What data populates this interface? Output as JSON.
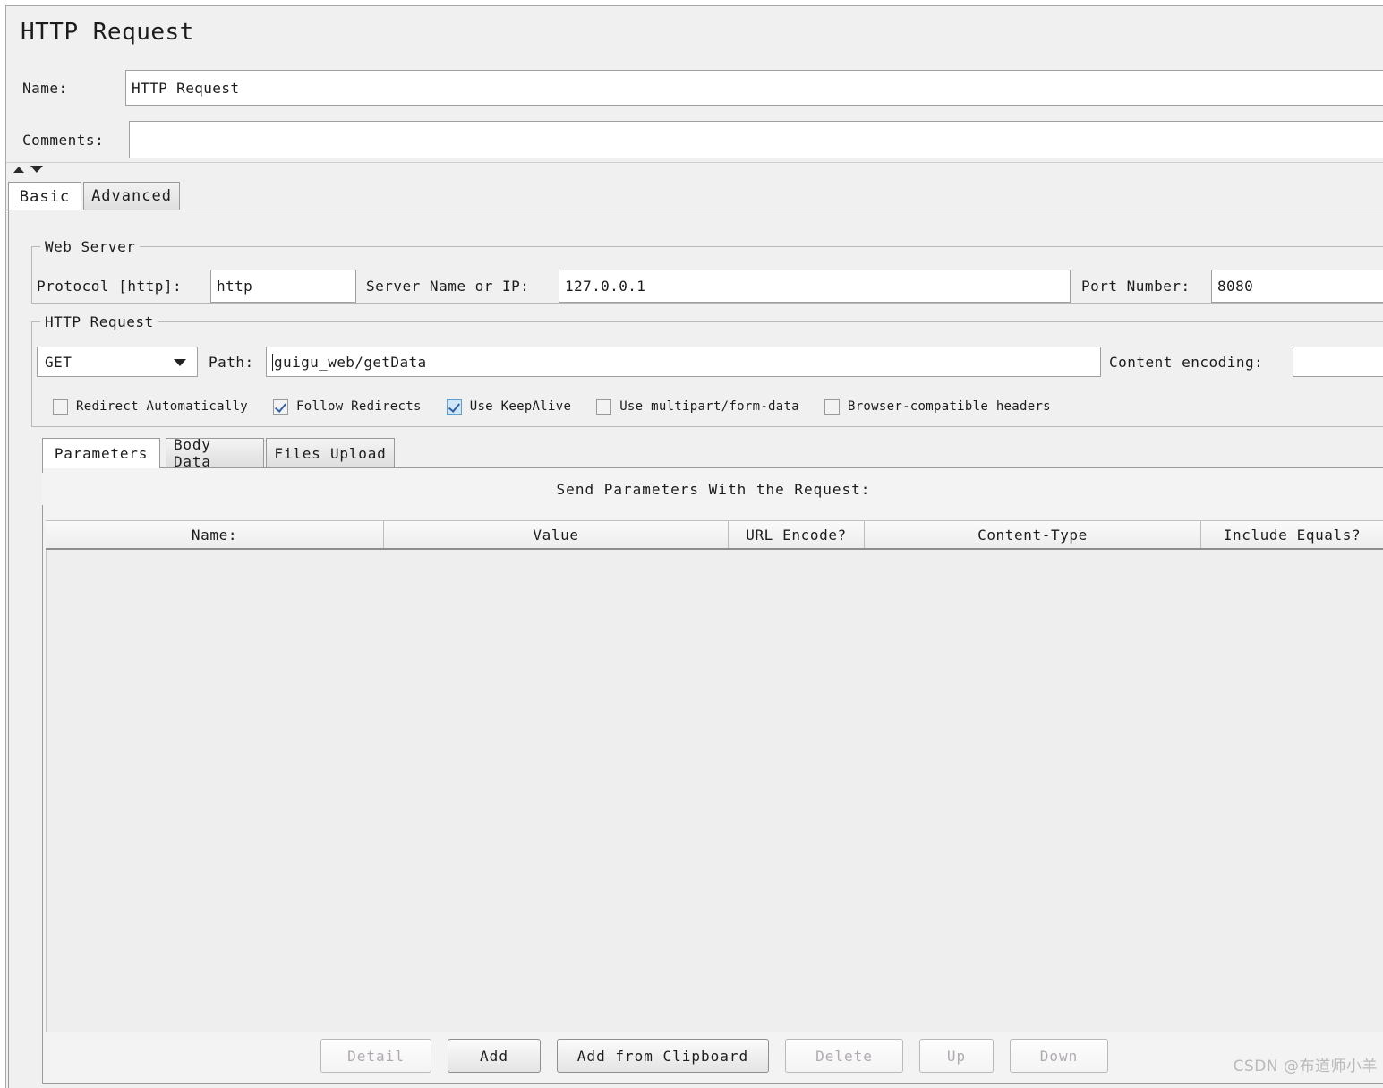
{
  "window": {
    "title": "HTTP Request"
  },
  "header": {
    "name_label": "Name:",
    "name_value": "HTTP Request",
    "comments_label": "Comments:",
    "comments_value": ""
  },
  "tabs": [
    {
      "label": "Basic",
      "selected": true
    },
    {
      "label": "Advanced",
      "selected": false
    }
  ],
  "web_server": {
    "group_title": "Web Server",
    "protocol_label": "Protocol [http]:",
    "protocol_value": "http",
    "server_label": "Server Name or IP:",
    "server_value": "127.0.0.1",
    "port_label": "Port Number:",
    "port_value": "8080"
  },
  "http_request": {
    "group_title": "HTTP Request",
    "method_value": "GET",
    "path_label": "Path:",
    "path_value": "guigu_web/getData",
    "content_encoding_label": "Content encoding:",
    "content_encoding_value": ""
  },
  "options": [
    {
      "label": "Redirect Automatically",
      "checked": false,
      "focused": false
    },
    {
      "label": "Follow Redirects",
      "checked": true,
      "focused": false
    },
    {
      "label": "Use KeepAlive",
      "checked": true,
      "focused": true
    },
    {
      "label": "Use multipart/form-data",
      "checked": false,
      "focused": false
    },
    {
      "label": "Browser-compatible headers",
      "checked": false,
      "focused": false
    }
  ],
  "inner_tabs": [
    {
      "label": "Parameters",
      "selected": true
    },
    {
      "label": "Body Data",
      "selected": false
    },
    {
      "label": "Files Upload",
      "selected": false
    }
  ],
  "parameters_panel": {
    "caption": "Send Parameters With the Request:",
    "columns": [
      "Name:",
      "Value",
      "URL Encode?",
      "Content-Type",
      "Include Equals?"
    ],
    "rows": []
  },
  "buttons": [
    {
      "label": "Detail",
      "enabled": false
    },
    {
      "label": "Add",
      "enabled": true
    },
    {
      "label": "Add from Clipboard",
      "enabled": true
    },
    {
      "label": "Delete",
      "enabled": false
    },
    {
      "label": "Up",
      "enabled": false
    },
    {
      "label": "Down",
      "enabled": false
    }
  ],
  "watermark": "CSDN @布道师小羊"
}
